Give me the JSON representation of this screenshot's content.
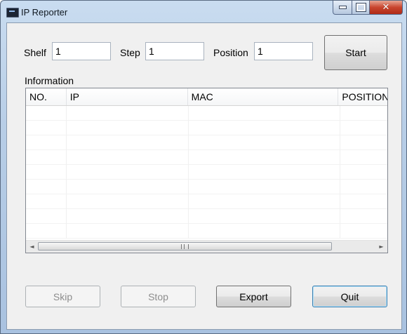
{
  "window": {
    "title": "IP Reporter",
    "caption_buttons": {
      "minimize_icon": "minimize-icon",
      "maximize_icon": "maximize-icon",
      "close_icon": "close-icon",
      "close_glyph": "✕"
    }
  },
  "form": {
    "shelf_label": "Shelf",
    "shelf_value": "1",
    "step_label": "Step",
    "step_value": "1",
    "position_label": "Position",
    "position_value": "1",
    "start_label": "Start"
  },
  "information": {
    "label": "Information",
    "columns": [
      "NO.",
      "IP",
      "MAC",
      "POSITION"
    ],
    "rows": [],
    "scrollbar": {
      "left_arrow": "◄",
      "right_arrow": "►"
    }
  },
  "footer": {
    "skip_label": "Skip",
    "stop_label": "Stop",
    "export_label": "Export",
    "quit_label": "Quit"
  },
  "colors": {
    "accent": "#3c7fb1",
    "window_frame": "#b7cde6",
    "close_button": "#c8452e"
  }
}
